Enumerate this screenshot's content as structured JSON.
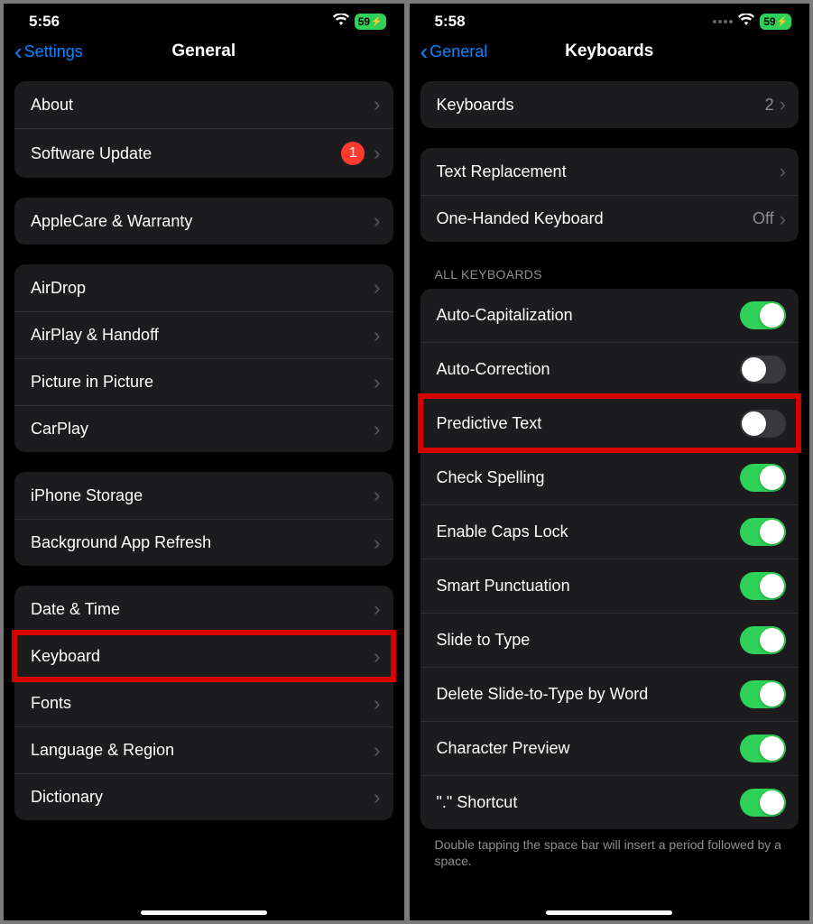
{
  "left": {
    "status": {
      "time": "5:56",
      "battery": "59"
    },
    "nav": {
      "back": "Settings",
      "title": "General"
    },
    "groups": [
      {
        "rows": [
          {
            "label": "About",
            "chevron": true
          },
          {
            "label": "Software Update",
            "badge": "1",
            "chevron": true
          }
        ]
      },
      {
        "rows": [
          {
            "label": "AppleCare & Warranty",
            "chevron": true
          }
        ]
      },
      {
        "rows": [
          {
            "label": "AirDrop",
            "chevron": true
          },
          {
            "label": "AirPlay & Handoff",
            "chevron": true
          },
          {
            "label": "Picture in Picture",
            "chevron": true
          },
          {
            "label": "CarPlay",
            "chevron": true
          }
        ]
      },
      {
        "rows": [
          {
            "label": "iPhone Storage",
            "chevron": true
          },
          {
            "label": "Background App Refresh",
            "chevron": true
          }
        ]
      },
      {
        "rows": [
          {
            "label": "Date & Time",
            "chevron": true
          },
          {
            "label": "Keyboard",
            "chevron": true,
            "highlight": true
          },
          {
            "label": "Fonts",
            "chevron": true
          },
          {
            "label": "Language & Region",
            "chevron": true
          },
          {
            "label": "Dictionary",
            "chevron": true
          }
        ]
      }
    ]
  },
  "right": {
    "status": {
      "time": "5:58",
      "battery": "59",
      "signal": true
    },
    "nav": {
      "back": "General",
      "title": "Keyboards"
    },
    "groups": [
      {
        "rows": [
          {
            "label": "Keyboards",
            "value": "2",
            "chevron": true
          }
        ]
      },
      {
        "rows": [
          {
            "label": "Text Replacement",
            "chevron": true
          },
          {
            "label": "One-Handed Keyboard",
            "value": "Off",
            "chevron": true
          }
        ]
      },
      {
        "header": "ALL KEYBOARDS",
        "rows": [
          {
            "label": "Auto-Capitalization",
            "toggle": true
          },
          {
            "label": "Auto-Correction",
            "toggle": false
          },
          {
            "label": "Predictive Text",
            "toggle": false,
            "highlight": true
          },
          {
            "label": "Check Spelling",
            "toggle": true
          },
          {
            "label": "Enable Caps Lock",
            "toggle": true
          },
          {
            "label": "Smart Punctuation",
            "toggle": true
          },
          {
            "label": "Slide to Type",
            "toggle": true
          },
          {
            "label": "Delete Slide-to-Type by Word",
            "toggle": true
          },
          {
            "label": "Character Preview",
            "toggle": true
          },
          {
            "label": "\".\" Shortcut",
            "toggle": true
          }
        ],
        "footer": "Double tapping the space bar will insert a period followed by a space."
      }
    ]
  }
}
